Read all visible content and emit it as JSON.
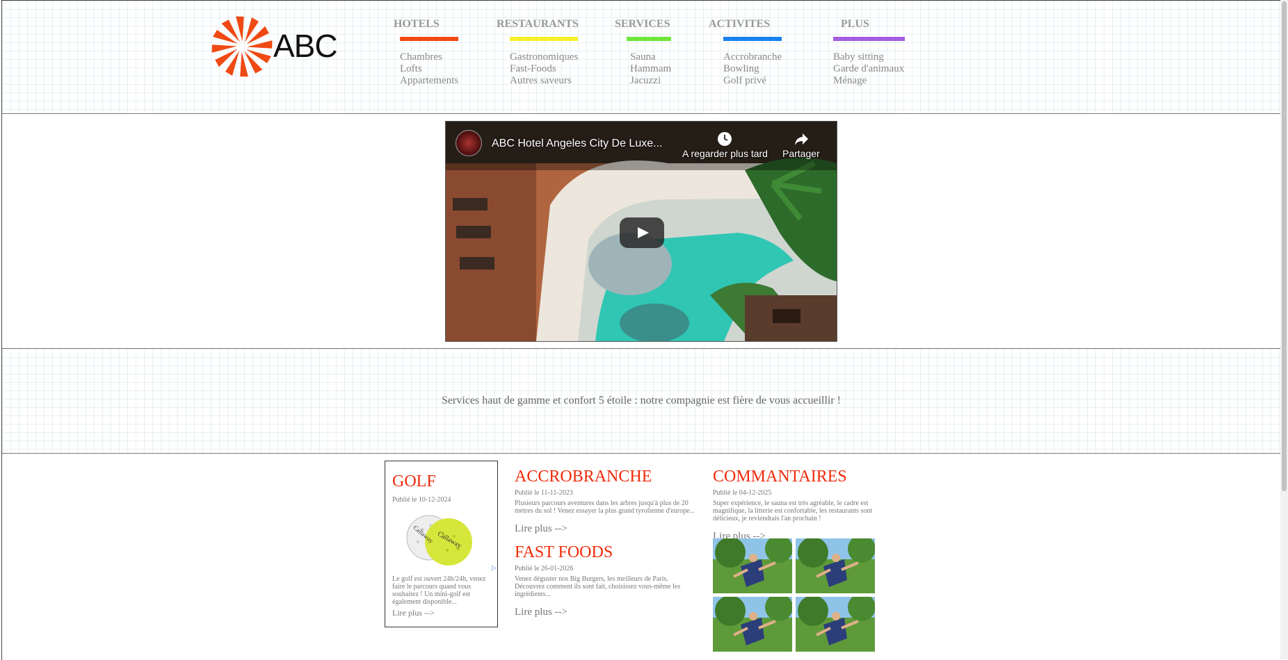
{
  "logo": {
    "text": "ABC",
    "color": "#f04a14"
  },
  "nav": [
    {
      "title": "HOTELS",
      "color": "#f04a14",
      "items": [
        "Chambres",
        "Lofts",
        "Appartements"
      ]
    },
    {
      "title": "RESTAURANTS",
      "color": "#f5f02a",
      "items": [
        "Gastronomiques",
        "Fast-Foods",
        "Autres saveurs"
      ]
    },
    {
      "title": "SERVICES",
      "color": "#6ee63a",
      "items": [
        "Sauna",
        "Hammam",
        "Jacuzzi"
      ]
    },
    {
      "title": "ACTIVITES",
      "color": "#1a82f0",
      "items": [
        "Accrobranche",
        "Bowling",
        "Golf privé"
      ]
    },
    {
      "title": "PLUS",
      "color": "#a35ee0",
      "items": [
        "Baby sitting",
        "Garde d'animaux",
        "Ménage"
      ]
    }
  ],
  "video": {
    "title": "ABC Hotel Angeles City De Luxe...",
    "watch_later": "A regarder plus tard",
    "share": "Partager"
  },
  "tagline": "Services haut de gamme et confort 5 étoile : notre compagnie est fière de vous accueillir !",
  "articles": {
    "golf": {
      "title": "GOLF",
      "date": "Publié le 10-12-2024",
      "text": "Le golf est ouvert 24h/24h, venez faire le parcours quand vous souhaitez ! Un mini-golf est également disponible...",
      "read_more": "Lire plus -->",
      "ad_marker": "▷"
    },
    "accrobranche": {
      "title": "ACCROBRANCHE",
      "date": "Publié le 11-11-2023",
      "text": "Plusieurs parcours aventures dans les arbres jusqu'à plus de 20 mètres du sol ! Venez essayer la plus grand tyrolienne d'europe...",
      "read_more": "Lire plus -->"
    },
    "fastfoods": {
      "title": "FAST FOODS",
      "date": "Publié le 26-01-2026",
      "text": "Venez déguster nos Big Burgers, les meilleurs de Paris. Découvrez comment ils sont fait, choisissez vous-même les ingrédients...",
      "read_more": "Lire plus -->"
    },
    "commentaires": {
      "title": "COMMANTAIRES",
      "date": "Publié le 04-12-2025",
      "text": "Super expérience, le sauna est très agréable, le cadre est magnifique, la litterie est confortable, les restaurants sont délicieux, je reviendrais l'an prochain !",
      "read_more": "Lire plus -->"
    }
  },
  "accent_color": "#f02a0a"
}
